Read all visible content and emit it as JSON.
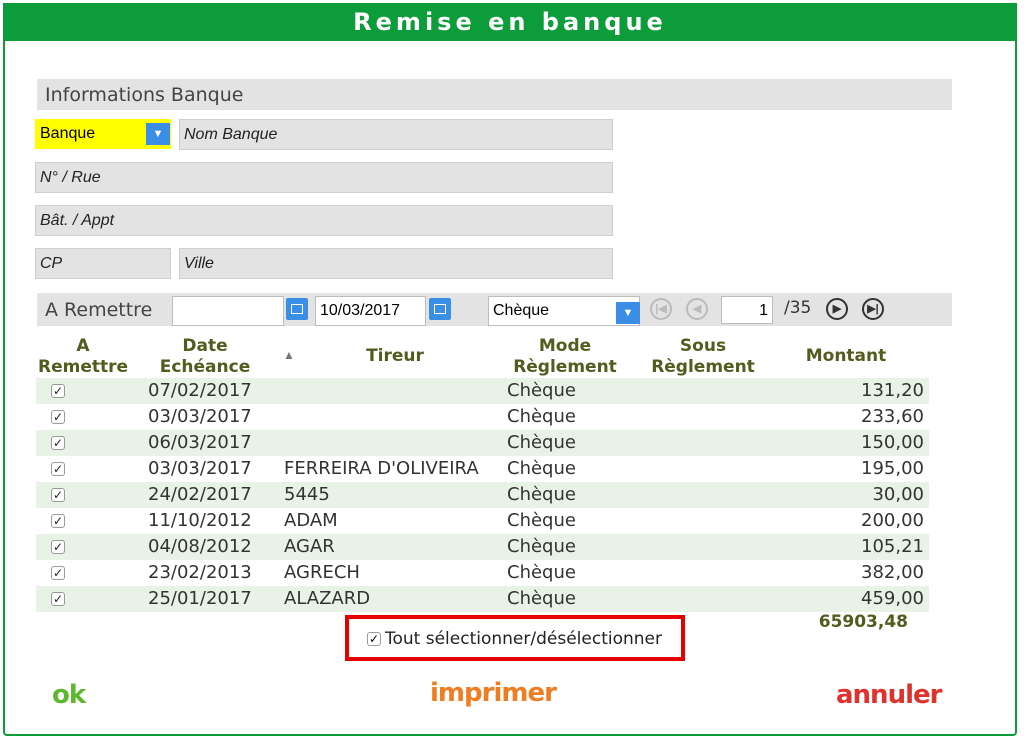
{
  "title": "Remise en banque",
  "bank": {
    "section_title": "Informations Banque",
    "banque_label": "Banque",
    "nom_banque": "Nom Banque",
    "rue": "N° / Rue",
    "bat": "Bât. / Appt",
    "cp": "CP",
    "ville": "Ville"
  },
  "remettre": {
    "section_title": "A Remettre",
    "date_from": "",
    "date_to": "10/03/2017",
    "mode": "Chèque",
    "page": "1",
    "page_total": "/35"
  },
  "table": {
    "headers": {
      "a_remettre": "A\nRemettre",
      "date": "Date\nEchéance",
      "tireur": "Tireur",
      "mode": "Mode\nRèglement",
      "sous": "Sous\nRèglement",
      "montant": "Montant"
    },
    "rows": [
      {
        "checked": "✓",
        "date": "07/02/2017",
        "tireur": "",
        "mode": "Chèque",
        "montant": "131,20"
      },
      {
        "checked": "✓",
        "date": "03/03/2017",
        "tireur": "",
        "mode": "Chèque",
        "montant": "233,60"
      },
      {
        "checked": "✓",
        "date": "06/03/2017",
        "tireur": "",
        "mode": "Chèque",
        "montant": "150,00"
      },
      {
        "checked": "✓",
        "date": "03/03/2017",
        "tireur": "FERREIRA D'OLIVEIRA",
        "mode": "Chèque",
        "montant": "195,00"
      },
      {
        "checked": "✓",
        "date": "24/02/2017",
        "tireur": "5445",
        "mode": "Chèque",
        "montant": "30,00"
      },
      {
        "checked": "✓",
        "date": "11/10/2012",
        "tireur": "ADAM",
        "mode": "Chèque",
        "montant": "200,00"
      },
      {
        "checked": "✓",
        "date": "04/08/2012",
        "tireur": "AGAR",
        "mode": "Chèque",
        "montant": "105,21"
      },
      {
        "checked": "✓",
        "date": "23/02/2013",
        "tireur": "AGRECH",
        "mode": "Chèque",
        "montant": "382,00"
      },
      {
        "checked": "✓",
        "date": "25/01/2017",
        "tireur": "ALAZARD",
        "mode": "Chèque",
        "montant": "459,00"
      }
    ],
    "total": "65903,48"
  },
  "select_all": {
    "checked": "✓",
    "label": "Tout sélectionner/désélectionner"
  },
  "actions": {
    "ok": "ok",
    "print": "imprimer",
    "cancel": "annuler"
  },
  "colors": {
    "title_bar": "#0c9c3a",
    "header_text": "#535b1e",
    "ok": "#5cb82e",
    "print": "#ef7d22",
    "cancel": "#e0312d",
    "highlight": "#e60000"
  },
  "icons": {
    "dropdown": "chevron-down-icon",
    "calendar": "calendar-icon",
    "first": "first-page-icon",
    "prev": "prev-page-icon",
    "next": "next-page-icon",
    "last": "last-page-icon",
    "sort": "sort-arrow-icon"
  }
}
